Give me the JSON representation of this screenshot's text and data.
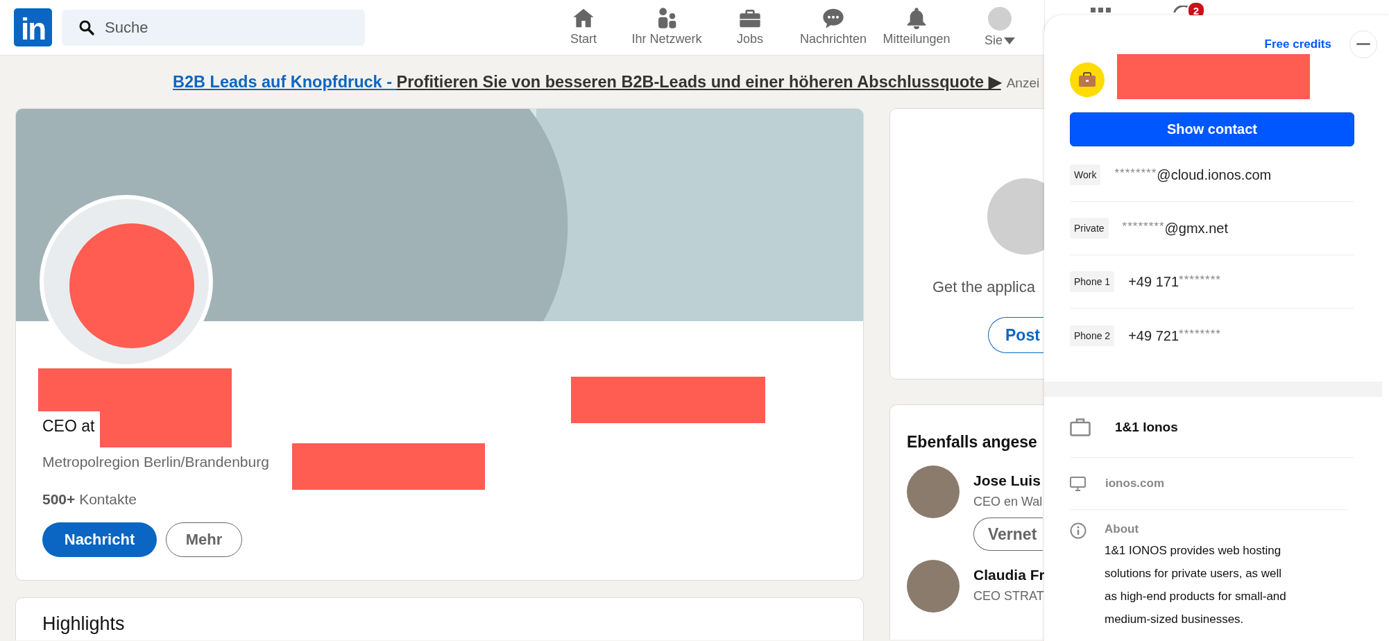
{
  "nav": {
    "logo": "in",
    "search_placeholder": "Suche",
    "items": [
      {
        "label": "Start"
      },
      {
        "label": "Ihr Netzwerk"
      },
      {
        "label": "Jobs"
      },
      {
        "label": "Nachrichten"
      },
      {
        "label": "Mitteilungen"
      },
      {
        "label": "Sie"
      }
    ],
    "apps_badge": "2"
  },
  "ad": {
    "link": "B2B Leads auf Knopfdruck - ",
    "text": "Profitieren Sie von besseren B2B-Leads und einer höheren Abschlussquote ▶",
    "tag": "Anzei"
  },
  "profile": {
    "headline": "CEO at",
    "location": "Metropolregion Berlin/Brandenburg",
    "connections": "**500+** Kontakte",
    "buttons": [
      {
        "label": "Nachricht",
        "kind": "primary"
      },
      {
        "label": "Mehr",
        "kind": "secondary"
      }
    ]
  },
  "highlights": {
    "title": "Highlights"
  },
  "app_card": {
    "text": "Get the applica",
    "button": "Post"
  },
  "also_viewed": {
    "title": "Ebenfalls angese",
    "people": [
      {
        "name": "Jose Luis",
        "headline": "CEO en Wal",
        "button": "Vernet"
      },
      {
        "name": "Claudia Fr",
        "headline": "CEO STRAT"
      }
    ]
  },
  "panel": {
    "credits": "Free credits",
    "button": "Show contact",
    "contacts": [
      {
        "label": "Work",
        "parts": [
          {
            "text": "********",
            "masked": true
          },
          {
            "text": "@cloud.ionos.com",
            "masked": false
          }
        ]
      },
      {
        "label": "Private",
        "parts": [
          {
            "text": "********",
            "masked": true
          },
          {
            "text": "@gmx.net",
            "masked": false
          }
        ]
      },
      {
        "label": "Phone 1",
        "parts": [
          {
            "text": "+49 171",
            "masked": false
          },
          {
            "text": "********",
            "masked": true
          }
        ]
      },
      {
        "label": "Phone 2",
        "parts": [
          {
            "text": "+49 721",
            "masked": false
          },
          {
            "text": "********",
            "masked": true
          }
        ]
      }
    ],
    "company": "1&1 Ionos",
    "website": "ionos.com",
    "about_label": "About",
    "about": "1&1 IONOS provides web hosting solutions for private users, as well as high-end products for small-and medium-sized businesses."
  }
}
